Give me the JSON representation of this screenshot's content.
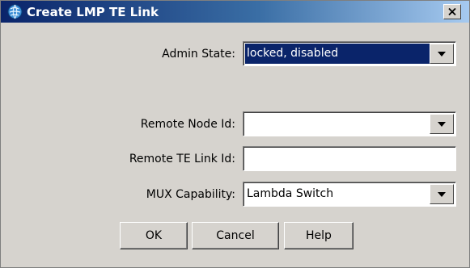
{
  "window": {
    "title": "Create LMP TE Link",
    "close_symbol": "×"
  },
  "form": {
    "admin_state": {
      "label": "Admin State:",
      "value": "locked, disabled"
    },
    "remote_node_id": {
      "label": "Remote Node Id:",
      "value": ""
    },
    "remote_te_link_id": {
      "label": "Remote TE Link Id:",
      "value": ""
    },
    "mux_capability": {
      "label": "MUX Capability:",
      "value": "Lambda Switch"
    }
  },
  "buttons": {
    "ok": "OK",
    "cancel": "Cancel",
    "help": "Help"
  },
  "icons": {
    "app": "app-globe-icon",
    "close": "close-icon",
    "dropdown": "chevron-down-icon"
  },
  "colors": {
    "titlebar_start": "#0a246a",
    "titlebar_end": "#a6caf0",
    "selection": "#0a246a",
    "dialog_bg": "#d6d3ce"
  }
}
